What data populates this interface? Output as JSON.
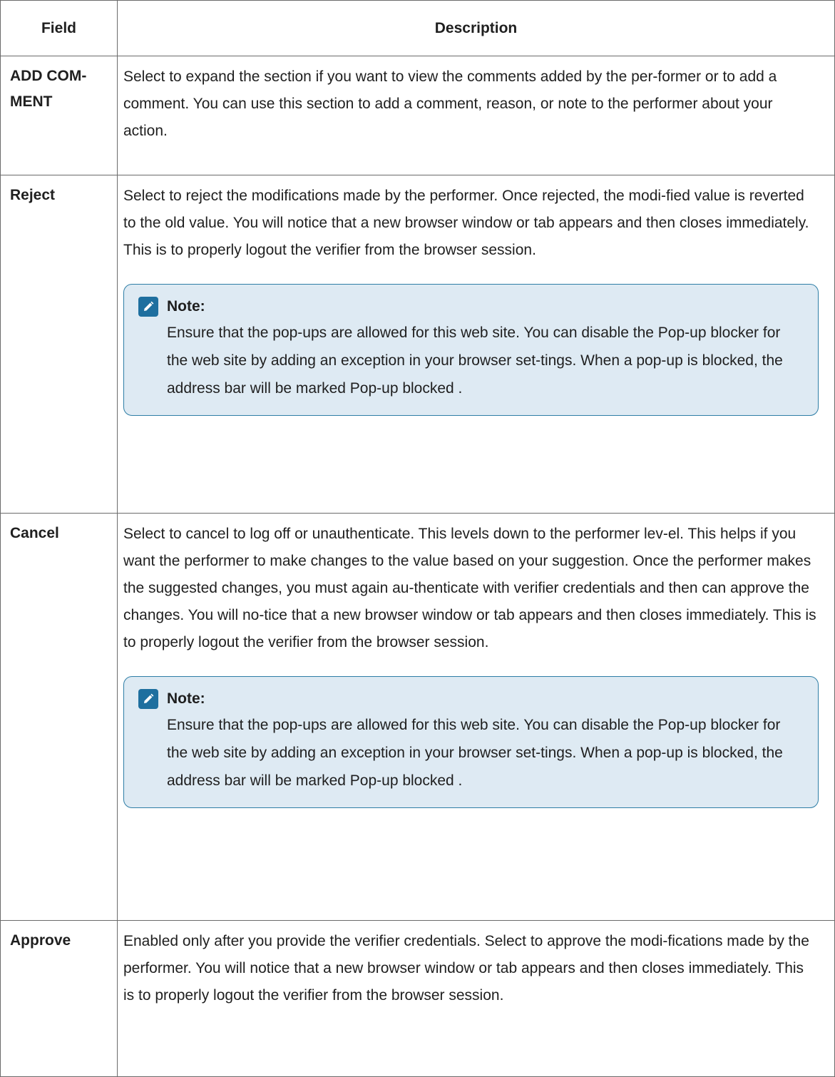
{
  "table": {
    "header": {
      "field": "Field",
      "description": "Description"
    },
    "rows": [
      {
        "field": "ADD COM-MENT",
        "description": "Select to expand the section if you want to view the comments added by the per-former or to add a comment. You can use this section to add a comment, reason, or note to the performer about your action."
      },
      {
        "field": "Reject",
        "description": "Select to reject the modifications made by the performer. Once rejected, the modi-fied value is reverted to the old value. You will notice that a new browser window or tab appears and then closes immediately. This is to properly logout the verifier from the browser session.",
        "note": {
          "icon": "pencil-note-icon",
          "label": "Note:",
          "text": "Ensure that the pop-ups are allowed for this web site. You can disable the Pop-up blocker for the web site by adding an exception in your browser set-tings. When a pop-up is blocked, the address bar will be marked Pop-up blocked ."
        }
      },
      {
        "field": "Cancel",
        "description": "Select to cancel to log off or unauthenticate. This levels down to the performer lev-el. This helps if you want the performer to make changes to the value based on your suggestion. Once the performer makes the suggested changes, you must again au-thenticate with verifier credentials and then can approve the changes. You will no-tice that a new browser window or tab appears and then closes immediately. This is to properly logout the verifier from the browser session.",
        "note": {
          "icon": "pencil-note-icon",
          "label": "Note:",
          "text": "Ensure that the pop-ups are allowed for this web site. You can disable the Pop-up blocker for the web site by adding an exception in your browser set-tings. When a pop-up is blocked, the address bar will be marked Pop-up blocked ."
        }
      },
      {
        "field": "Approve",
        "description": "Enabled only after you provide the verifier credentials. Select to approve the modi-fications made by the performer. You will notice that a new browser window or tab appears and then closes immediately. This is to properly logout the verifier from the browser session."
      }
    ]
  },
  "colors": {
    "border": "#6b6b6b",
    "note_border": "#2e7ea6",
    "note_background": "#deeaf3",
    "note_icon": "#1e6f9f"
  }
}
